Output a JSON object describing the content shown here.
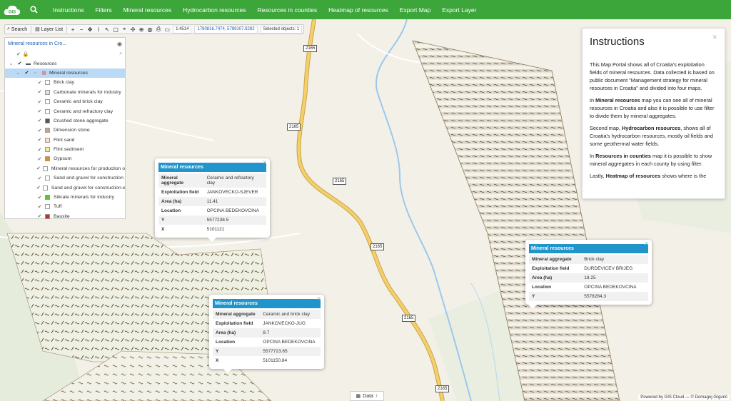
{
  "topbar": {
    "items": [
      "Instructions",
      "Filters",
      "Mineral resources",
      "Hydrocarbon resources",
      "Resources in counties",
      "Heatmap of resources",
      "Export Map",
      "Export Layer"
    ]
  },
  "toolbar": {
    "search_label": "Search",
    "layer_list_label": "Layer List",
    "scale": "1:4514",
    "coords": "1780816.7474, 5789107.8282",
    "selected": "Selected objects: 1"
  },
  "layer_panel": {
    "title": "Mineral resources in Cro...",
    "resources_label": "Resources",
    "group_label": "Mineral resources",
    "layers": [
      {
        "label": "Brick clay",
        "color": "#ffffff"
      },
      {
        "label": "Carbonate minerals for industry",
        "color": "#cfe6f7"
      },
      {
        "label": "Ceramic and brick clay",
        "color": "#ffffff"
      },
      {
        "label": "Ceramic and refractory clay",
        "color": "#ffffff"
      },
      {
        "label": "Crushed stone aggregate",
        "color": "#555555"
      },
      {
        "label": "Dimension stone",
        "color": "#c9a38f"
      },
      {
        "label": "Flint sand",
        "color": "#f3e6b0"
      },
      {
        "label": "Flint sediment",
        "color": "#f3e6b0"
      },
      {
        "label": "Gypsum",
        "color": "#e88a1a"
      },
      {
        "label": "Mineral resources for production of",
        "color": "#ffffff"
      },
      {
        "label": "Sand and gravel for construction",
        "color": "#ffffff"
      },
      {
        "label": "Sand and gravel for construction-e",
        "color": "#ffffff"
      },
      {
        "label": "Silicate minerals for industry",
        "color": "#5bc23b"
      },
      {
        "label": "Tuff",
        "color": "#ffffff"
      },
      {
        "label": "Bauxite",
        "color": "#d4242c"
      }
    ]
  },
  "popups": [
    {
      "title": "Mineral resources",
      "rows": [
        {
          "k": "Mineral aggregate",
          "v": "Ceramic and refractory clay"
        },
        {
          "k": "Exploitation field",
          "v": "JANKOVECKO-SJEVER"
        },
        {
          "k": "Area (ha)",
          "v": "11.41"
        },
        {
          "k": "Location",
          "v": "OPCINA BEDEKOVCINA"
        },
        {
          "k": "Y",
          "v": "5577238.5"
        },
        {
          "k": "X",
          "v": "5101121"
        }
      ]
    },
    {
      "title": "Mineral resources",
      "rows": [
        {
          "k": "Mineral aggregate",
          "v": "Ceramic and brick clay"
        },
        {
          "k": "Exploitation field",
          "v": "JANKOVECKO-JUG"
        },
        {
          "k": "Area (ha)",
          "v": "8.7"
        },
        {
          "k": "Location",
          "v": "OPCINA BEDEKOVCINA"
        },
        {
          "k": "Y",
          "v": "5577723.65"
        },
        {
          "k": "X",
          "v": "5101150.84"
        }
      ]
    },
    {
      "title": "Mineral resources",
      "rows": [
        {
          "k": "Mineral aggregate",
          "v": "Brick clay"
        },
        {
          "k": "Exploitation field",
          "v": "DURDEVICEV BRIJEG"
        },
        {
          "k": "Area (ha)",
          "v": "18.25"
        },
        {
          "k": "Location",
          "v": "OPCINA BEDEKOVCINA"
        },
        {
          "k": "Y",
          "v": "5578284.3"
        }
      ]
    }
  ],
  "instructions": {
    "title": "Instructions",
    "p1": "This Map Portal shows all of Croatia's exploitation fields of mineral resources. Data collected is based on public document \"Management strategy for mineral resources in Croatia\" and divided into four maps.",
    "p2a": "In ",
    "p2b": "Mineral resources",
    "p2c": " map you can see all of mineral resources in Croatia and also it is possible to use filter to divide them by mineral aggregates.",
    "p3a": "Second map, ",
    "p3b": "Hydrocarbon resources",
    "p3c": ", shows all of Croatia's hydrocarbon resources, mostly oil fields and some geothermal water fields.",
    "p4a": "In ",
    "p4b": "Resources in counties",
    "p4c": " map it is possible to show mineral aggregates in each county by using filter.",
    "p5a": "Lastly, ",
    "p5b": "Heatmap of resources",
    "p5c": " shows where is the"
  },
  "map": {
    "road_labels": [
      "2165",
      "2165",
      "2165",
      "2165",
      "2165",
      "2165"
    ]
  },
  "databar": {
    "label": "Data"
  },
  "attribution": "Powered by GIS Cloud — © Domagoj Grgurić"
}
